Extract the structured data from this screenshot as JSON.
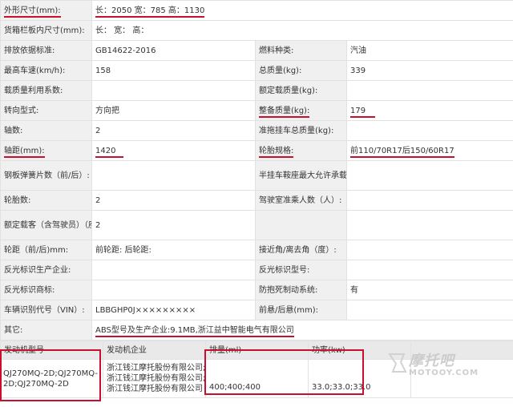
{
  "rows": [
    {
      "l1": "外形尺寸(mm):",
      "v1": "长：2050 宽：785 高：1130"
    },
    {
      "l1": "货箱栏板内尺寸(mm):",
      "v1": "长：  宽：  高："
    },
    {
      "l1": "排放依据标准:",
      "v1": "GB14622-2016",
      "l2": "燃料种类:",
      "v2": "汽油"
    },
    {
      "l1": "最高车速(km/h):",
      "v1": "158",
      "l2": "总质量(kg):",
      "v2": "339"
    },
    {
      "l1": "载质量利用系数:",
      "v1": "",
      "l2": "额定载质量(kg):",
      "v2": ""
    },
    {
      "l1": "转向型式:",
      "v1": "方向把",
      "l2": "整备质量(kg):",
      "v2": "179"
    },
    {
      "l1": "轴数:",
      "v1": "2",
      "l2": "准拖挂车总质量(kg):",
      "v2": ""
    },
    {
      "l1": "轴距(mm):",
      "v1": "1420",
      "l2": "轮胎规格:",
      "v2": "前110/70R17后150/60R17"
    },
    {
      "l1": "钢板弹簧片数（前/后）:",
      "v1": "",
      "l2": "半挂车鞍座最大允许承载质量(kg):",
      "v2": ""
    },
    {
      "l1": "轮胎数:",
      "v1": "2",
      "l2": "驾驶室准乘人数（人）:",
      "v2": ""
    },
    {
      "l1": "额定载客（含驾驶员）（座位数）:",
      "v1": "2",
      "l2": "",
      "v2": ""
    },
    {
      "l1": "轮距（前/后)mm:",
      "v1": "前轮距: 后轮距:",
      "l2": "接近角/离去角（度）:",
      "v2": ""
    },
    {
      "l1": "反光标识生产企业:",
      "v1": "",
      "l2": "反光标识型号:",
      "v2": ""
    },
    {
      "l1": "反光标识商标:",
      "v1": "",
      "l2": "防抱死制动系统:",
      "v2": "有"
    },
    {
      "l1": "车辆识别代号（VIN）:",
      "v1": "LBBGHP0J×××××××××",
      "l2": "前悬/后悬(mm):",
      "v2": ""
    },
    {
      "l1": "其它:",
      "v1": "ABS型号及生产企业:9.1MB,浙江益中智能电气有限公司"
    }
  ],
  "engine": {
    "headers": [
      "发动机型号",
      "发动机企业",
      "排量(ml)",
      "功率(kw)"
    ],
    "model": "QJ270MQ-2D;QJ270MQ-2D;QJ270MQ-2D",
    "makers": [
      "浙江钱江摩托股份有限公司;",
      "浙江钱江摩托股份有限公司;",
      "浙江钱江摩托股份有限公司"
    ],
    "displacement": "400;400;400",
    "power": "33.0;33.0;33.0"
  },
  "watermark": {
    "cn": "摩托吧",
    "en": "MOTOOY.COM"
  },
  "colors": {
    "highlight": "#c8102e",
    "label_bg": "#f0f0f0",
    "header_bg": "#e9e9e9"
  }
}
